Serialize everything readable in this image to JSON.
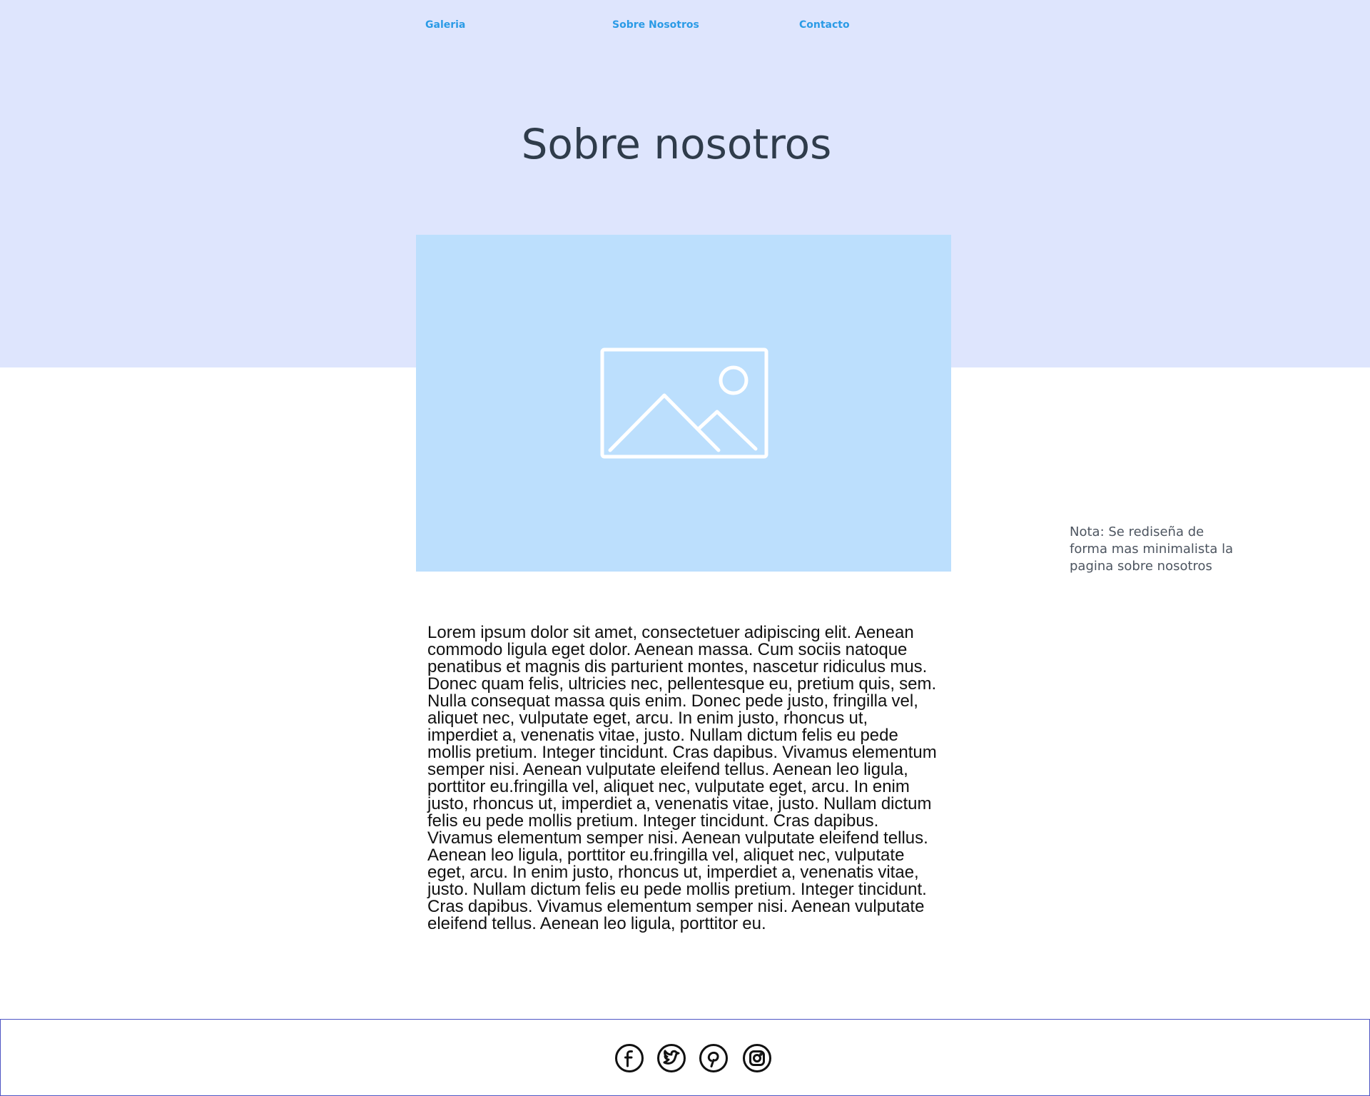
{
  "nav": {
    "items": [
      {
        "label": "Galeria"
      },
      {
        "label": "Sobre Nosotros"
      },
      {
        "label": "Contacto"
      }
    ]
  },
  "hero": {
    "title": "Sobre nosotros",
    "image_icon": "image-placeholder-icon"
  },
  "note": {
    "text": "Nota: Se rediseña de forma mas minimalista la pagina sobre nosotros"
  },
  "main": {
    "paragraph": "Lorem ipsum dolor sit amet, consectetuer adipiscing elit. Aenean commodo ligula eget dolor. Aenean massa. Cum sociis natoque penatibus et magnis dis parturient montes, nascetur ridiculus mus. Donec quam felis, ultricies nec, pellentesque eu, pretium quis, sem. Nulla consequat massa quis enim. Donec pede justo, fringilla vel, aliquet nec, vulputate eget, arcu. In enim justo, rhoncus ut, imperdiet a, venenatis vitae, justo. Nullam dictum felis eu pede mollis pretium. Integer tincidunt. Cras dapibus. Vivamus elementum semper nisi. Aenean vulputate eleifend tellus. Aenean leo ligula, porttitor eu.fringilla vel, aliquet nec, vulputate eget, arcu. In enim justo, rhoncus ut, imperdiet a, venenatis vitae, justo. Nullam dictum felis eu pede mollis pretium. Integer tincidunt. Cras dapibus. Vivamus elementum semper nisi. Aenean vulputate eleifend tellus. Aenean leo ligula, porttitor eu.fringilla vel, aliquet nec, vulputate eget, arcu. In enim justo, rhoncus ut, imperdiet a, venenatis vitae, justo. Nullam dictum felis eu pede mollis pretium. Integer tincidunt. Cras dapibus. Vivamus elementum semper nisi. Aenean vulputate eleifend tellus. Aenean leo ligula, porttitor eu."
  },
  "footer": {
    "social_icons": [
      "facebook-icon",
      "twitter-icon",
      "pinterest-icon",
      "instagram-icon"
    ]
  },
  "colors": {
    "hero_background": "#dee5fd",
    "nav_link": "#2b9be6",
    "image_placeholder": "#bcdffd",
    "title_text": "#2f3c4b",
    "footer_border": "#4e56c4"
  }
}
